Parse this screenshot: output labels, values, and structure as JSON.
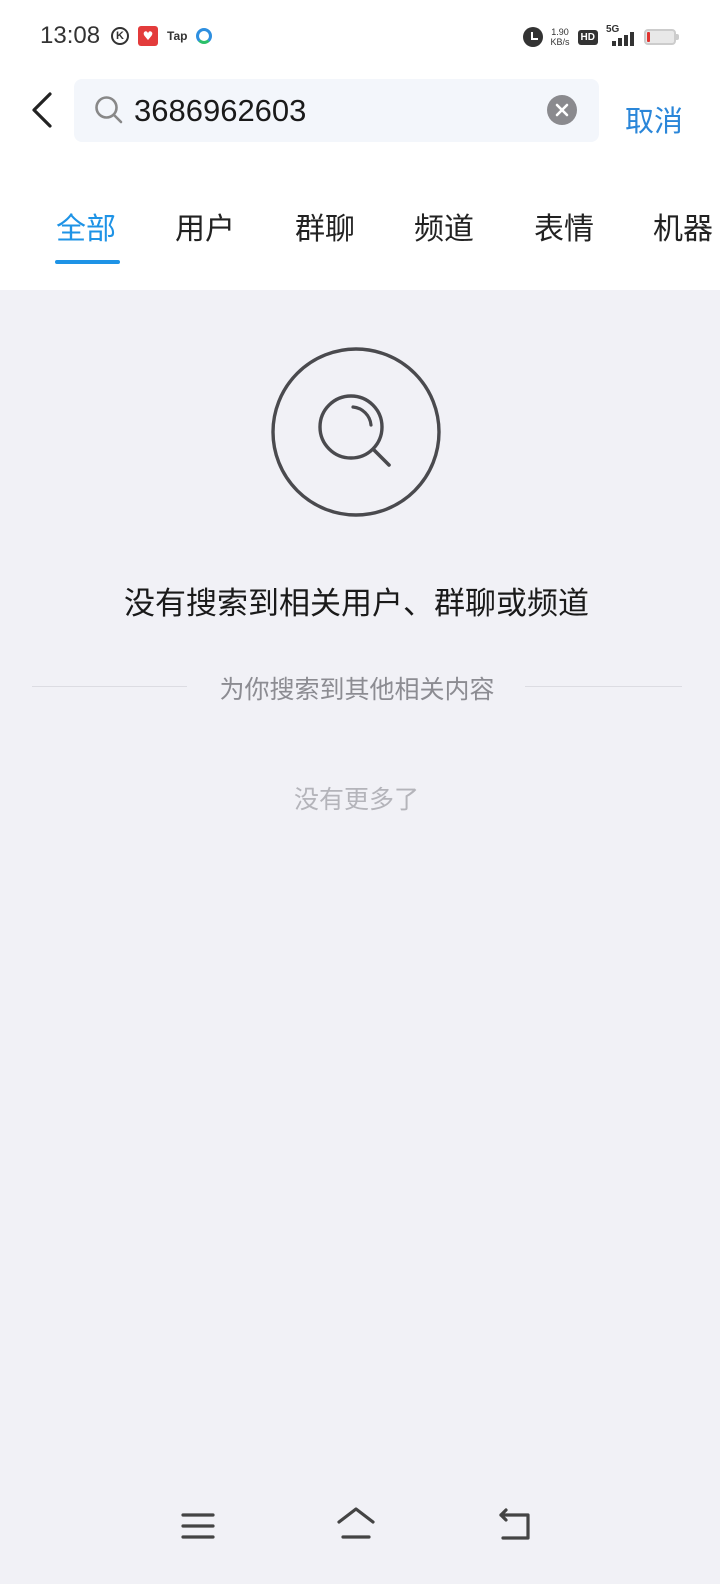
{
  "status_bar": {
    "time": "13:08",
    "left_icons": [
      "k-app-icon",
      "red-app-icon",
      "tap-app-icon",
      "blue-app-icon"
    ],
    "tap_label": "Tap",
    "net_speed_value": "1.90",
    "net_speed_unit": "KB/s",
    "hd_label": "HD",
    "network_label": "5G"
  },
  "header": {
    "search_value": "3686962603",
    "search_placeholder": "",
    "cancel_label": "取消"
  },
  "tabs": [
    {
      "label": "全部",
      "active": true
    },
    {
      "label": "用户",
      "active": false
    },
    {
      "label": "群聊",
      "active": false
    },
    {
      "label": "频道",
      "active": false
    },
    {
      "label": "表情",
      "active": false
    },
    {
      "label": "机器",
      "active": false
    }
  ],
  "empty_state": {
    "title": "没有搜索到相关用户、群聊或频道",
    "related_divider": "为你搜索到其他相关内容",
    "no_more": "没有更多了"
  },
  "colors": {
    "accent": "#1e93e6",
    "cancel": "#2a86d9",
    "background": "#f1f1f6"
  },
  "nav_bar": {
    "icons": [
      "menu-icon",
      "home-icon",
      "back-icon"
    ]
  }
}
